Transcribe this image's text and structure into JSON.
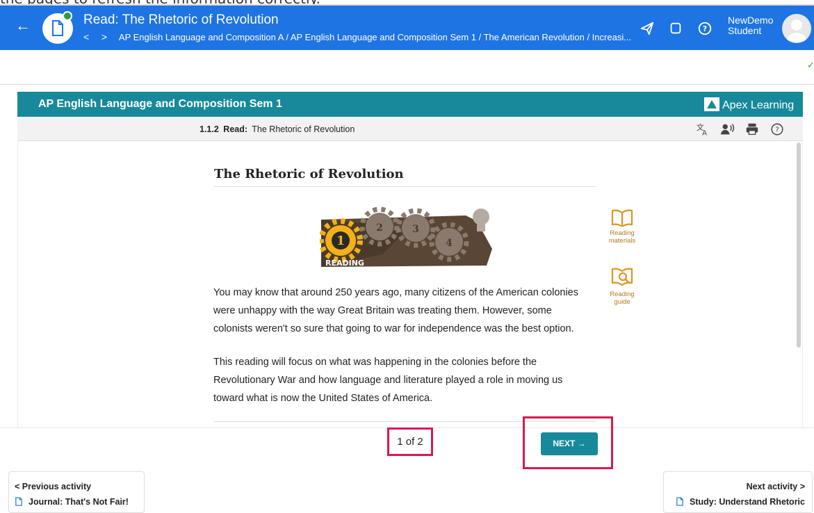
{
  "caption": "the pages to refresh the information correctly.",
  "header": {
    "title": "Read: The Rhetoric of Revolution",
    "breadcrumb": "AP English Language and Composition A / AP English Language and Composition Sem 1 / The American Revolution / Increasi...",
    "crumb_back": "<",
    "crumb_forward": ">",
    "user_line1": "NewDemo",
    "user_line2": "Student",
    "back_icon": "arrow-left-icon",
    "status_color": "#2e9b3c",
    "brand_color": "#1e74e2"
  },
  "course": {
    "title": "AP English Language and Composition Sem 1",
    "brand": "Apex Learning",
    "accent": "#17899a"
  },
  "lesson": {
    "number": "1.1.2",
    "kind": "Read:",
    "name": "The Rhetoric of Revolution"
  },
  "reading": {
    "title": "The Rhetoric of Revolution",
    "graphic_label": "READING",
    "gears": [
      "1",
      "2",
      "3",
      "4"
    ],
    "para1": "You may know that around 250 years ago, many citizens of the American colonies were unhappy with the way Great Britain was treating them. However, some colonists weren't so sure that going to war for independence was the best option.",
    "para2": "This reading will focus on what was happening in the colonies before the Revolutionary War and how language and literature played a role in moving us toward what is now the United States of America."
  },
  "side_tools": {
    "materials_label": "Reading materials",
    "guide_label": "Reading guide"
  },
  "pager": {
    "count": "1 of 2",
    "next_label": "NEXT →",
    "highlight_color": "#d8194f"
  },
  "nav": {
    "prev_label": "< Previous activity",
    "prev_name": "Journal: That's Not Fair!",
    "next_label": "Next activity >",
    "next_name": "Study: Understand Rhetoric"
  },
  "check": "✓"
}
